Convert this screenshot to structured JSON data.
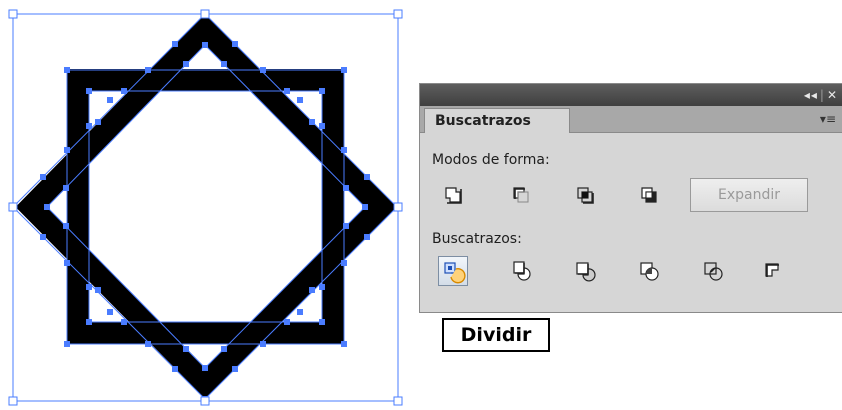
{
  "panel": {
    "tab_label": "Buscatrazos",
    "titlebar_collapse_icon": "double-chevron-left-icon",
    "titlebar_close_icon": "close-icon",
    "menu_icon": "panel-menu-icon",
    "shape_modes_label": "Modos de forma:",
    "shape_modes": [
      {
        "name": "unite-icon"
      },
      {
        "name": "minus-front-icon"
      },
      {
        "name": "intersect-icon"
      },
      {
        "name": "exclude-icon"
      }
    ],
    "expand_label": "Expandir",
    "pathfinders_label": "Buscatrazos:",
    "pathfinders": [
      {
        "name": "divide-icon",
        "active": true
      },
      {
        "name": "trim-icon"
      },
      {
        "name": "merge-icon"
      },
      {
        "name": "crop-icon"
      },
      {
        "name": "outline-icon"
      },
      {
        "name": "minus-back-icon"
      }
    ]
  },
  "caption": "Dividir",
  "colors": {
    "selection": "#4a7cff",
    "stroke": "#000000",
    "panel_bg": "#d6d6d6",
    "titlebar": "#4a4a4a"
  }
}
